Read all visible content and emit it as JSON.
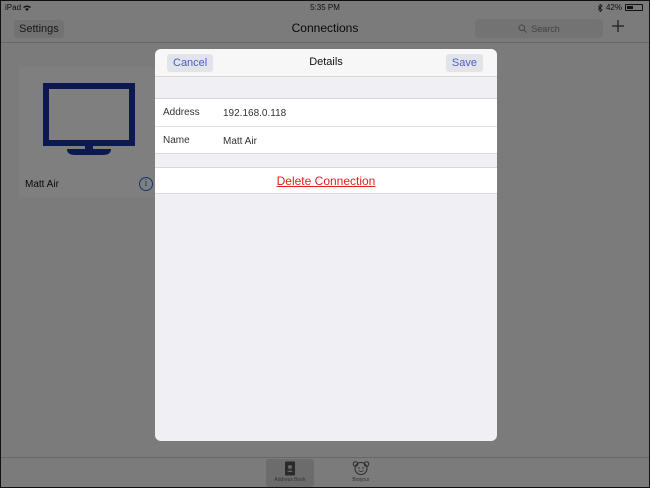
{
  "status_bar": {
    "device": "iPad",
    "time": "5:35 PM",
    "battery": "42%"
  },
  "navbar": {
    "settings_label": "Settings",
    "title": "Connections",
    "search_placeholder": "Search"
  },
  "card": {
    "label": "Matt Air",
    "info_glyph": "i"
  },
  "tabs": [
    {
      "label": "Address Book",
      "icon": "address-book-icon"
    },
    {
      "label": "Bonjour",
      "icon": "bonjour-icon"
    }
  ],
  "modal": {
    "title": "Details",
    "cancel_label": "Cancel",
    "save_label": "Save",
    "fields": [
      {
        "label": "Address",
        "value": "192.168.0.118"
      },
      {
        "label": "Name",
        "value": "Matt Air"
      }
    ],
    "delete_label": "Delete Connection"
  },
  "colors": {
    "accent": "#4a5fc1",
    "destructive": "#e02020",
    "monitor": "#1a2ea0"
  }
}
